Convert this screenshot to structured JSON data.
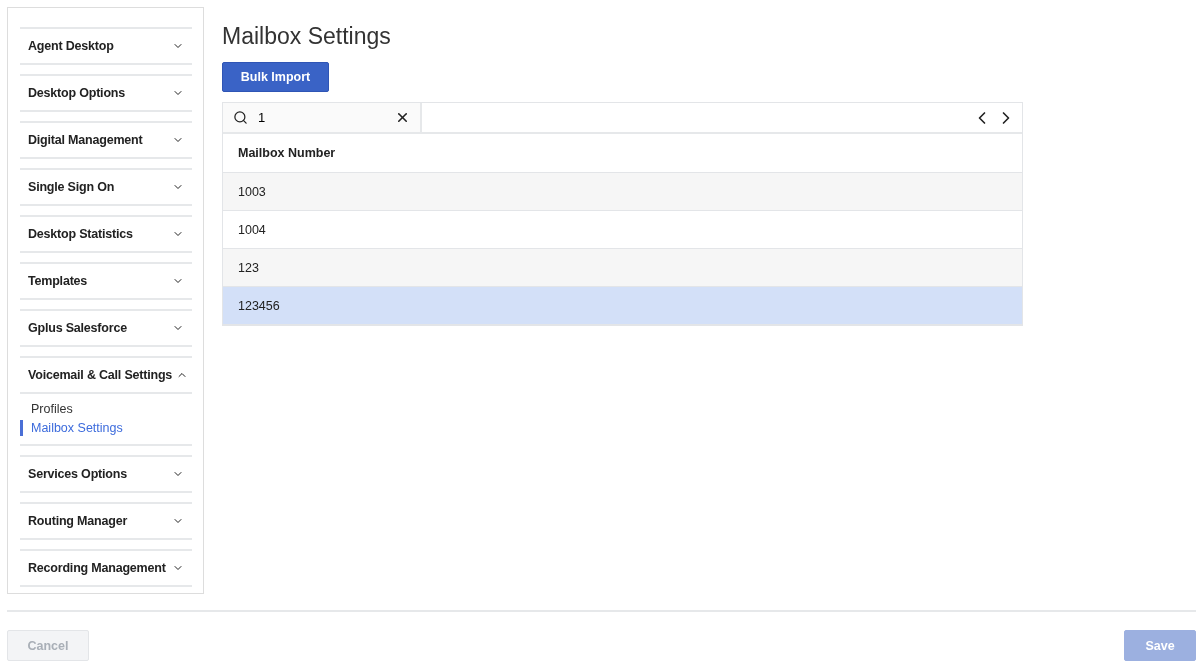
{
  "sidebar": {
    "sections": [
      {
        "label": "Agent Desktop",
        "expanded": false
      },
      {
        "label": "Desktop Options",
        "expanded": false
      },
      {
        "label": "Digital Management",
        "expanded": false
      },
      {
        "label": "Single Sign On",
        "expanded": false
      },
      {
        "label": "Desktop Statistics",
        "expanded": false
      },
      {
        "label": "Templates",
        "expanded": false
      },
      {
        "label": "Gplus Salesforce",
        "expanded": false
      },
      {
        "label": "Voicemail & Call Settings",
        "expanded": true,
        "children": [
          {
            "label": "Profiles",
            "selected": false
          },
          {
            "label": "Mailbox Settings",
            "selected": true
          }
        ]
      },
      {
        "label": "Services Options",
        "expanded": false
      },
      {
        "label": "Routing Manager",
        "expanded": false
      },
      {
        "label": "Recording Management",
        "expanded": false
      }
    ]
  },
  "page_title": "Mailbox Settings",
  "bulk_import_button": "Bulk Import",
  "search": {
    "value": "1"
  },
  "table": {
    "columns": [
      "Mailbox Number"
    ],
    "rows": [
      {
        "cells": [
          "1003"
        ],
        "selected": false
      },
      {
        "cells": [
          "1004"
        ],
        "selected": false
      },
      {
        "cells": [
          "123"
        ],
        "selected": false
      },
      {
        "cells": [
          "123456"
        ],
        "selected": true
      }
    ]
  },
  "footer": {
    "cancel": {
      "label": "Cancel",
      "disabled": true
    },
    "save": {
      "label": "Save",
      "disabled": true
    }
  }
}
